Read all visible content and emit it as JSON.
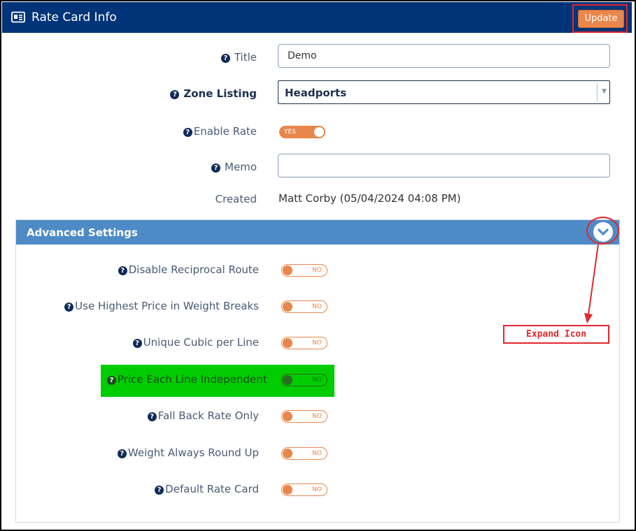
{
  "header": {
    "title": "Rate Card Info",
    "icon": "id-card-icon",
    "update_label": "Update"
  },
  "form": {
    "title_label": "Title",
    "title_value": "Demo",
    "zone_label": "Zone Listing",
    "zone_value": "Headports",
    "enable_label": "Enable Rate",
    "enable_value": "YES",
    "memo_label": "Memo",
    "memo_value": "",
    "created_label": "Created",
    "created_value": "Matt Corby (05/04/2024 04:08 PM)"
  },
  "advanced": {
    "title": "Advanced Settings",
    "expand_icon": "chevron-down-icon",
    "settings": [
      {
        "label": "Disable Reciprocal Route",
        "value": "NO"
      },
      {
        "label": "Use Highest Price in Weight Breaks",
        "value": "NO"
      },
      {
        "label": "Unique Cubic per Line",
        "value": "NO"
      },
      {
        "label": "Price Each Line Independent",
        "value": "NO"
      },
      {
        "label": "Fall Back Rate Only",
        "value": "NO"
      },
      {
        "label": "Weight Always Round Up",
        "value": "NO"
      },
      {
        "label": "Default Rate Card",
        "value": "NO"
      }
    ]
  },
  "annotation": {
    "callout_text": "Expand Icon",
    "color": "#e0282d",
    "highlight_color": "#00cc00"
  },
  "colors": {
    "header_bg": "#003478",
    "accent": "#e8874b",
    "section_bg": "#4e8bc6"
  }
}
